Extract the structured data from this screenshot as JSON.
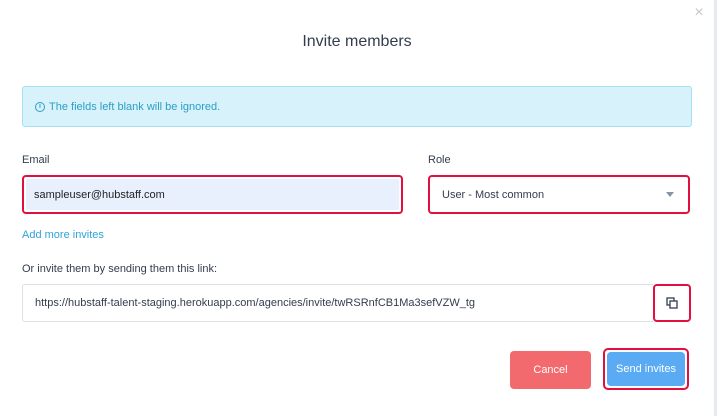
{
  "dialog": {
    "title": "Invite members",
    "close_glyph": "×"
  },
  "alert": {
    "icon": "info-icon",
    "text": "The fields left blank will be ignored.",
    "color": "#2a9fc6",
    "background": "#d7f2fa"
  },
  "form": {
    "email_label": "Email",
    "email_value": "sampleuser@hubstaff.com",
    "role_label": "Role",
    "role_selected": "User - Most common",
    "add_more_label": "Add more invites",
    "link_label": "Or invite them by sending them this link:",
    "invite_link": "https://hubstaff-talent-staging.herokuapp.com/agencies/invite/twRSRnfCB1Ma3sefVZW_tg",
    "copy_icon": "copy-icon"
  },
  "actions": {
    "cancel_label": "Cancel",
    "send_label": "Send invites",
    "cancel_color": "#f26a6e",
    "send_color": "#5aabf3"
  },
  "highlight_color": "#e0113e"
}
